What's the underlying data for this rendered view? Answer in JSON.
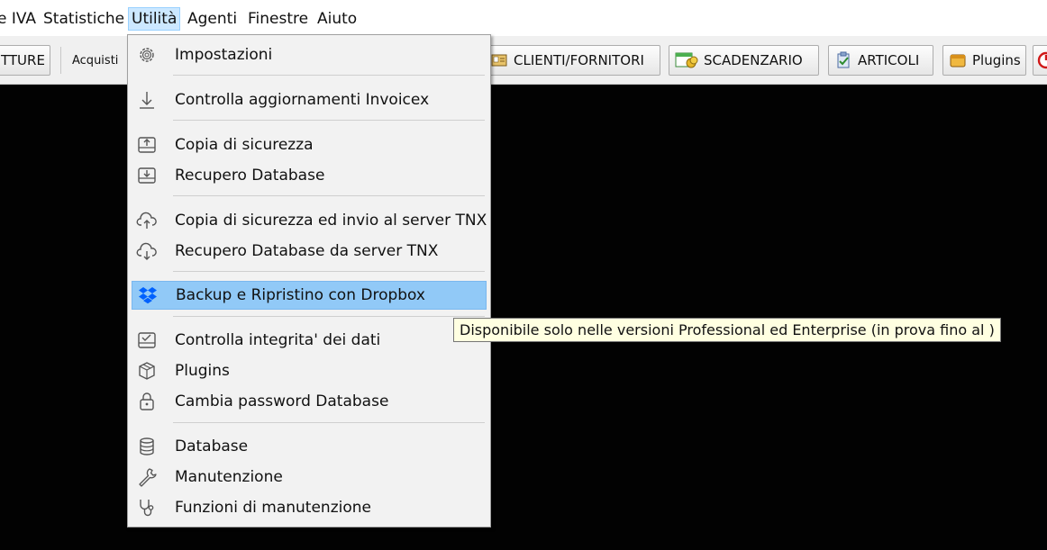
{
  "menubar": {
    "items": [
      "e IVA",
      "Statistiche",
      "Utilità",
      "Agenti",
      "Finestre",
      "Aiuto"
    ],
    "active": "Utilità"
  },
  "toolbar": {
    "fatture_label": "TTURE",
    "acquisti_label": "Acquisti",
    "clienti_label": "CLIENTI/FORNITORI",
    "scadenzario_label": "SCADENZARIO",
    "articoli_label": "ARTICOLI",
    "plugins_label": "Plugins"
  },
  "menu": {
    "items": [
      {
        "label": "Impostazioni",
        "icon": "gear-icon"
      },
      {
        "label": "Controlla aggiornamenti Invoicex",
        "icon": "download-arrow-icon"
      },
      {
        "label": "Copia di sicurezza",
        "icon": "upload-tray-icon"
      },
      {
        "label": "Recupero Database",
        "icon": "download-tray-icon"
      },
      {
        "label": "Copia di sicurezza ed invio al server TNX",
        "icon": "cloud-upload-icon"
      },
      {
        "label": "Recupero Database da server TNX",
        "icon": "cloud-download-icon"
      },
      {
        "label": "Backup e Ripristino con Dropbox",
        "icon": "dropbox-icon"
      },
      {
        "label": "Controlla integrita' dei dati",
        "icon": "check-tray-icon"
      },
      {
        "label": "Plugins",
        "icon": "cube-icon"
      },
      {
        "label": "Cambia password Database",
        "icon": "lock-icon"
      },
      {
        "label": "Database",
        "icon": "database-icon"
      },
      {
        "label": "Manutenzione",
        "icon": "wrench-icon"
      },
      {
        "label": "Funzioni di manutenzione",
        "icon": "stethoscope-icon"
      }
    ],
    "highlighted": "Backup e Ripristino con Dropbox"
  },
  "tooltip": {
    "text": "Disponibile solo nelle versioni Professional ed Enterprise (in prova fino al )"
  },
  "colors": {
    "menu_highlight": "#91c9f7",
    "menubar_active": "#cce8ff",
    "tooltip_bg": "#ffffe1",
    "workspace_bg": "#020202"
  }
}
